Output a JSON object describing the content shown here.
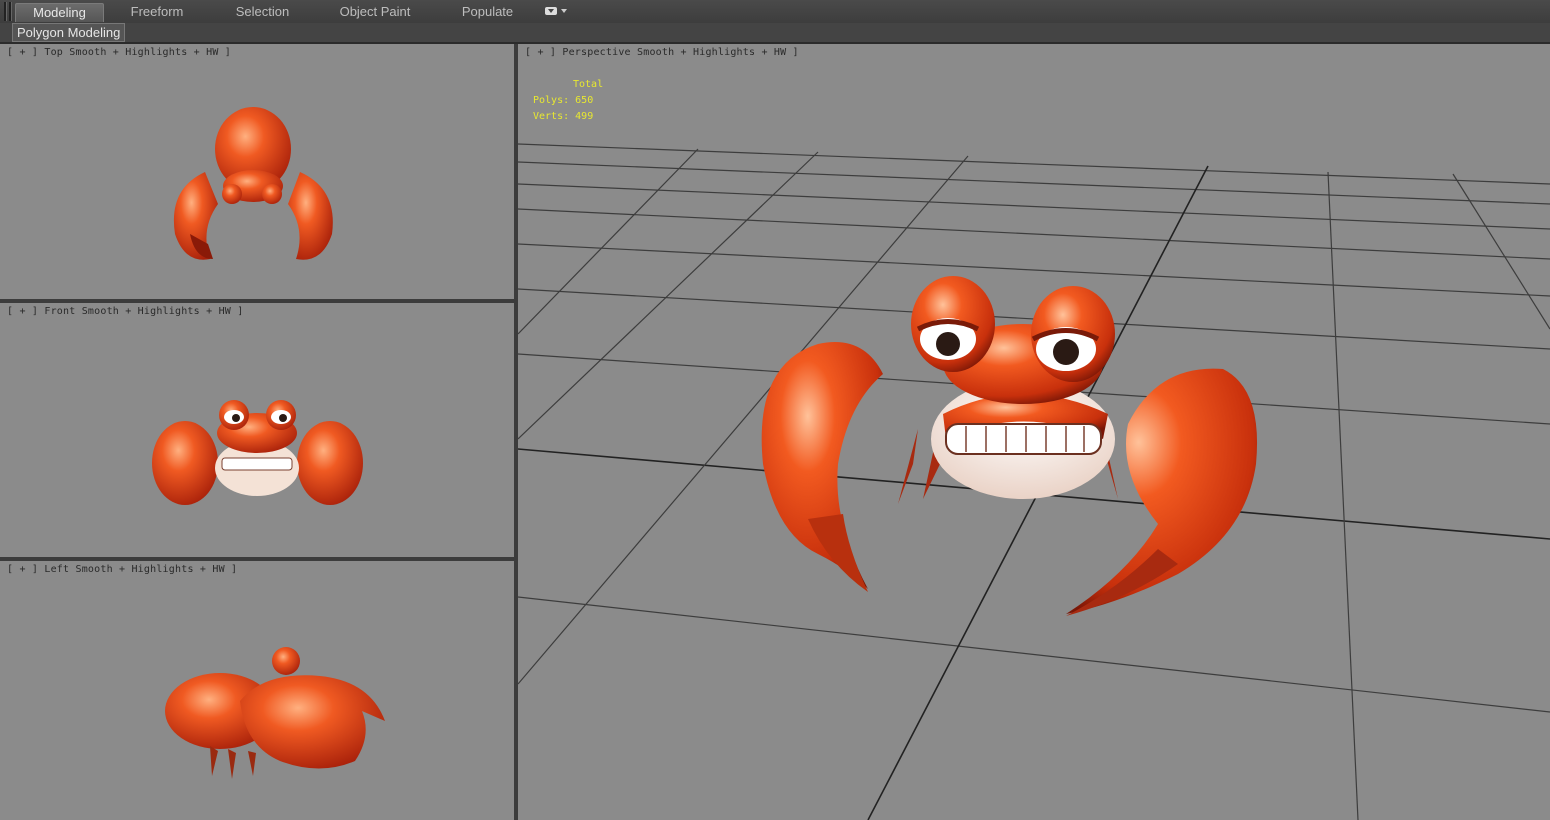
{
  "ribbon": {
    "tabs": [
      {
        "label": "Modeling",
        "active": true
      },
      {
        "label": "Freeform",
        "active": false
      },
      {
        "label": "Selection",
        "active": false
      },
      {
        "label": "Object Paint",
        "active": false
      },
      {
        "label": "Populate",
        "active": false
      }
    ],
    "dropdown_icon": "menu-dropdown-icon"
  },
  "panel": {
    "label": "Polygon Modeling"
  },
  "viewports": {
    "top": {
      "plus": "[ + ]",
      "view": "Top",
      "shading": "Smooth + Highlights",
      "mode": "HW ]"
    },
    "front": {
      "plus": "[ + ]",
      "view": "Front",
      "shading": "Smooth + Highlights",
      "mode": "HW ]"
    },
    "left": {
      "plus": "[ + ]",
      "view": "Left",
      "shading": "Smooth + Highlights",
      "mode": "HW ]"
    },
    "perspective": {
      "plus": "[ + ]",
      "view": "Perspective",
      "shading": "Smooth + Highlights",
      "mode": "HW ]"
    }
  },
  "stats": {
    "header": "Total",
    "polys_label": "Polys:",
    "polys_value": "650",
    "verts_label": "Verts:",
    "verts_value": "499"
  },
  "colors": {
    "viewport_bg": "#8b8b8b",
    "grid": "#3d3d3d",
    "crab_shell": "#e8461c",
    "crab_highlight": "#ff9a6a",
    "stats_text": "#e8e830"
  }
}
